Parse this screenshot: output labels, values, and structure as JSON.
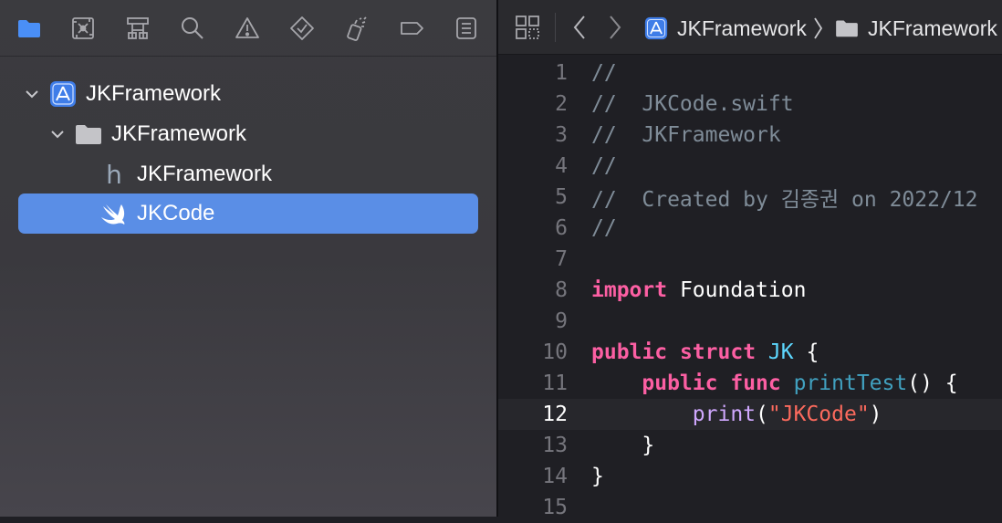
{
  "colors": {
    "navigator_bg": "#3a393e",
    "editor_bg": "#1f1f24",
    "selection": "#5a8ee6",
    "active_tool": "#4a8ff7",
    "keyword": "#fc5fa3",
    "comment": "#7f8c98",
    "string": "#fc6a5d",
    "type": "#5dd8ff",
    "func_decl": "#41a1c0",
    "func_call": "#d0a8ff"
  },
  "navigator": {
    "toolbar": [
      {
        "icon": "folder-icon",
        "active": true
      },
      {
        "icon": "source-control-icon",
        "active": false
      },
      {
        "icon": "symbol-hierarchy-icon",
        "active": false
      },
      {
        "icon": "search-icon",
        "active": false
      },
      {
        "icon": "warning-icon",
        "active": false
      },
      {
        "icon": "test-diamond-icon",
        "active": false
      },
      {
        "icon": "debug-spray-icon",
        "active": false
      },
      {
        "icon": "breakpoint-icon",
        "active": false
      },
      {
        "icon": "report-list-icon",
        "active": false
      }
    ],
    "tree": [
      {
        "label": "JKFramework",
        "icon": "xcode-project-icon",
        "expanded": true,
        "level": 0
      },
      {
        "label": "JKFramework",
        "icon": "folder-icon",
        "expanded": true,
        "level": 1
      },
      {
        "label": "JKFramework",
        "icon": "header-file-icon",
        "level": 2
      },
      {
        "label": "JKCode",
        "icon": "swift-icon",
        "level": 2,
        "selected": true
      }
    ]
  },
  "editor": {
    "breadcrumb": [
      {
        "label": "JKFramework",
        "icon": "xcode-project-icon"
      },
      {
        "label": "JKFramework",
        "icon": "folder-icon"
      }
    ],
    "current_line": 12,
    "lines": [
      {
        "n": "1",
        "tokens": [
          {
            "t": "//",
            "c": "comment"
          }
        ]
      },
      {
        "n": "2",
        "tokens": [
          {
            "t": "//  JKCode.swift",
            "c": "comment"
          }
        ]
      },
      {
        "n": "3",
        "tokens": [
          {
            "t": "//  JKFramework",
            "c": "comment"
          }
        ]
      },
      {
        "n": "4",
        "tokens": [
          {
            "t": "//",
            "c": "comment"
          }
        ]
      },
      {
        "n": "5",
        "tokens": [
          {
            "t": "//  Created by 김종권 on 2022/12",
            "c": "comment"
          }
        ]
      },
      {
        "n": "6",
        "tokens": [
          {
            "t": "//",
            "c": "comment"
          }
        ]
      },
      {
        "n": "7",
        "tokens": []
      },
      {
        "n": "8",
        "tokens": [
          {
            "t": "import",
            "c": "keyword"
          },
          {
            "t": " Foundation",
            "c": "plain"
          }
        ]
      },
      {
        "n": "9",
        "tokens": []
      },
      {
        "n": "10",
        "tokens": [
          {
            "t": "public",
            "c": "keyword"
          },
          {
            "t": " ",
            "c": "plain"
          },
          {
            "t": "struct",
            "c": "keyword"
          },
          {
            "t": " ",
            "c": "plain"
          },
          {
            "t": "JK",
            "c": "type"
          },
          {
            "t": " {",
            "c": "plain"
          }
        ]
      },
      {
        "n": "11",
        "tokens": [
          {
            "t": "    ",
            "c": "plain"
          },
          {
            "t": "public",
            "c": "keyword"
          },
          {
            "t": " ",
            "c": "plain"
          },
          {
            "t": "func",
            "c": "keyword"
          },
          {
            "t": " ",
            "c": "plain"
          },
          {
            "t": "printTest",
            "c": "funcdecl"
          },
          {
            "t": "() {",
            "c": "plain"
          }
        ]
      },
      {
        "n": "12",
        "tokens": [
          {
            "t": "        ",
            "c": "plain"
          },
          {
            "t": "print",
            "c": "call"
          },
          {
            "t": "(",
            "c": "plain"
          },
          {
            "t": "\"JKCode\"",
            "c": "string"
          },
          {
            "t": ")",
            "c": "plain"
          }
        ]
      },
      {
        "n": "13",
        "tokens": [
          {
            "t": "    }",
            "c": "plain"
          }
        ]
      },
      {
        "n": "14",
        "tokens": [
          {
            "t": "}",
            "c": "plain"
          }
        ]
      },
      {
        "n": "15",
        "tokens": []
      }
    ]
  }
}
